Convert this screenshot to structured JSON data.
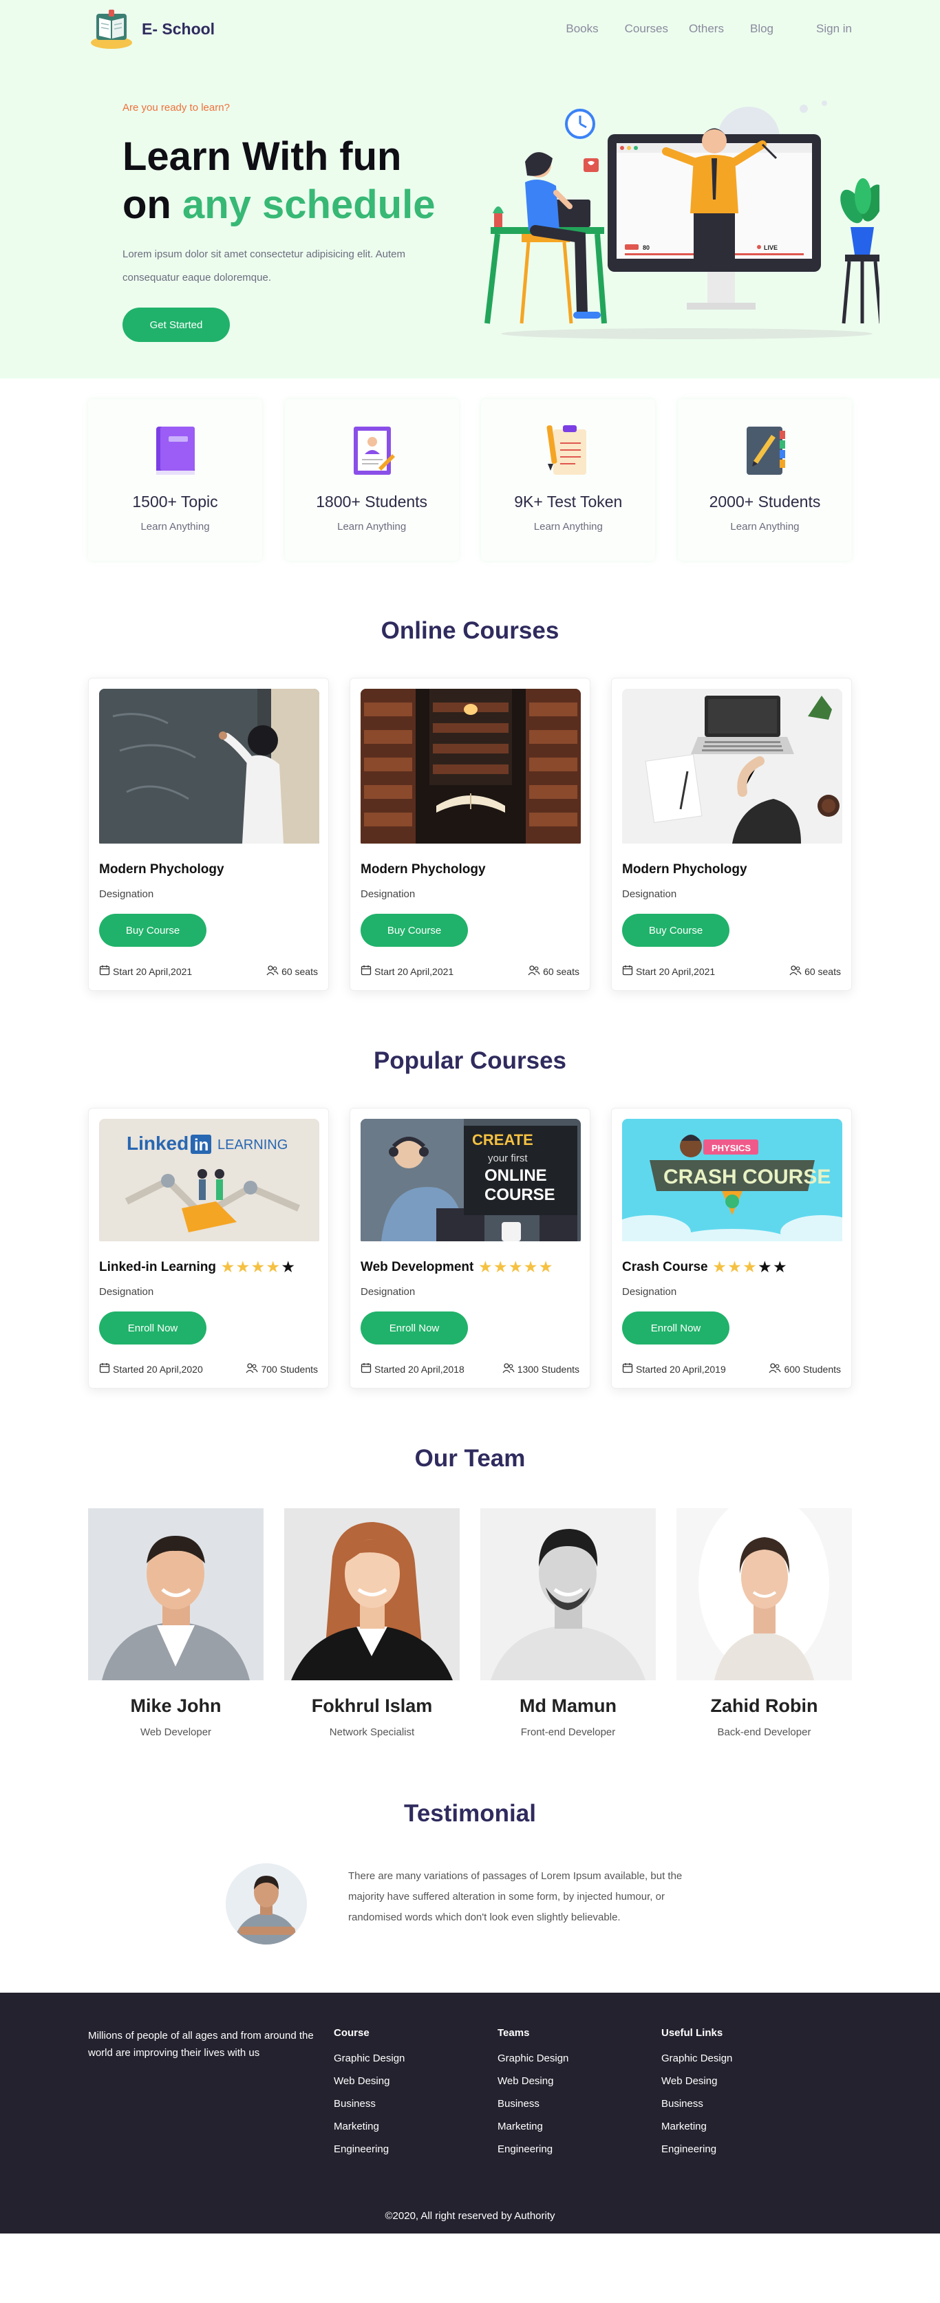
{
  "brand": {
    "name": "E- School"
  },
  "nav": {
    "items": [
      {
        "label": "Books"
      },
      {
        "label": "Courses"
      },
      {
        "label": "Others"
      },
      {
        "label": "Blog"
      }
    ],
    "signin": "Sign in"
  },
  "hero": {
    "eyebrow": "Are you ready to learn?",
    "title_line1": "Learn With fun",
    "title_line2_prefix": "on ",
    "title_line2_accent": "any schedule",
    "description": "Lorem ipsum dolor sit amet consectetur adipisicing elit. Autem consequatur eaque doloremque.",
    "button": "Get Started",
    "video_badge_count": "80",
    "video_badge_live": "LIVE"
  },
  "stats": [
    {
      "number": "1500+ Topic",
      "sub": "Learn Anything",
      "icon": "book-icon"
    },
    {
      "number": "1800+ Students",
      "sub": "Learn Anything",
      "icon": "certificate-icon"
    },
    {
      "number": "9K+ Test Token",
      "sub": "Learn Anything",
      "icon": "clipboard-icon"
    },
    {
      "number": "2000+ Students",
      "sub": "Learn Anything",
      "icon": "notebook-icon"
    }
  ],
  "online_courses": {
    "title": "Online Courses",
    "items": [
      {
        "title": "Modern Phychology",
        "designation": "Designation",
        "button": "Buy Course",
        "start": "Start 20 April,2021",
        "seats": "60 seats"
      },
      {
        "title": "Modern Phychology",
        "designation": "Designation",
        "button": "Buy Course",
        "start": "Start 20 April,2021",
        "seats": "60 seats"
      },
      {
        "title": "Modern Phychology",
        "designation": "Designation",
        "button": "Buy Course",
        "start": "Start 20 April,2021",
        "seats": "60 seats"
      }
    ]
  },
  "popular_courses": {
    "title": "Popular Courses",
    "items": [
      {
        "title": "Linked-in Learning",
        "rating": 4,
        "designation": "Designation",
        "button": "Enroll Now",
        "start": "Started 20 April,2020",
        "students": "700 Students",
        "thumb_brand": "Linked",
        "thumb_in": "in",
        "thumb_word": "LEARNING"
      },
      {
        "title": "Web Development",
        "rating": 5,
        "designation": "Designation",
        "button": "Enroll Now",
        "start": "Started 20 April,2018",
        "students": "1300 Students",
        "thumb_line1": "CREATE",
        "thumb_line2": "your first",
        "thumb_line3": "ONLINE",
        "thumb_line4": "COURSE"
      },
      {
        "title": "Crash Course",
        "rating": 3,
        "designation": "Designation",
        "button": "Enroll Now",
        "start": "Started 20 April,2019",
        "students": "600 Students",
        "thumb_ribbon": "PHYSICS",
        "thumb_word": "CRASH COURSE"
      }
    ]
  },
  "team": {
    "title": "Our Team",
    "members": [
      {
        "name": "Mike John",
        "role": "Web Developer"
      },
      {
        "name": "Fokhrul Islam",
        "role": "Network Specialist"
      },
      {
        "name": "Md Mamun",
        "role": "Front-end Developer"
      },
      {
        "name": "Zahid Robin",
        "role": "Back-end Developer"
      }
    ]
  },
  "testimonial": {
    "title": "Testimonial",
    "text": "There are many variations of passages of Lorem Ipsum available, but the majority have suffered alteration in some form, by injected humour, or randomised words which don't look even slightly believable."
  },
  "footer": {
    "intro": "Millions of people of all ages and from around the world are improving their lives with us",
    "columns": [
      {
        "title": "Course",
        "links": [
          "Graphic Design",
          "Web Desing",
          "Business",
          "Marketing",
          "Engineering"
        ]
      },
      {
        "title": "Teams",
        "links": [
          "Graphic Design",
          "Web Desing",
          "Business",
          "Marketing",
          "Engineering"
        ]
      },
      {
        "title": "Useful Links",
        "links": [
          "Graphic Design",
          "Web Desing",
          "Business",
          "Marketing",
          "Engineering"
        ]
      }
    ],
    "copyright": "©2020, All right reserved by Authority"
  },
  "colors": {
    "accent": "#20b26a",
    "heading": "#2f2b5e",
    "hero_bg": "#ecfdee",
    "footer_bg": "#25222f",
    "star": "#f5c142",
    "eyebrow": "#f0703a"
  }
}
